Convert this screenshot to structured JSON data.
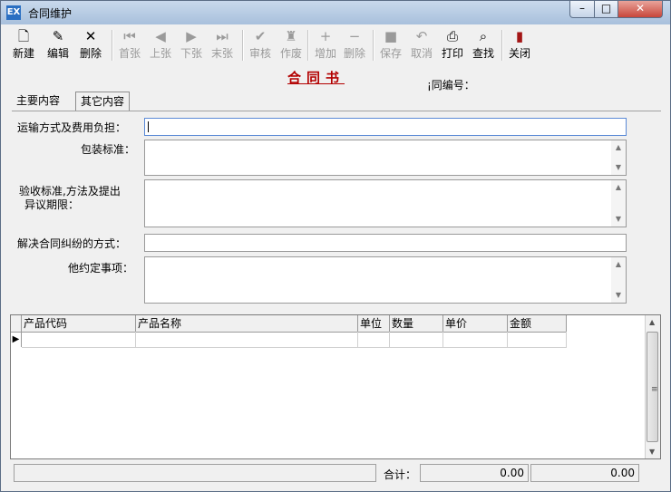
{
  "window": {
    "title": "合同维护",
    "app_icon": "EX"
  },
  "toolbar": {
    "new": "新建",
    "edit": "编辑",
    "delete": "删除",
    "first": "首张",
    "prev": "上张",
    "next": "下张",
    "last": "末张",
    "review": "审核",
    "void": "作废",
    "add": "增加",
    "remove": "删除",
    "save": "保存",
    "cancel": "取消",
    "print": "打印",
    "find": "查找",
    "close": "关闭"
  },
  "doc_title": "合同书",
  "contract_no_label": "¡同编号：",
  "tabs": {
    "main": "主要内容",
    "other": "其它内容"
  },
  "fields": {
    "transport": "运输方式及费用负担：",
    "packaging": "包装标准：",
    "inspection_line1": "验收标准,方法及提出",
    "inspection_line2": "异议期限：",
    "dispute": "解决合同纠纷的方式：",
    "other_terms": "他约定事项："
  },
  "grid": {
    "columns": [
      "产品代码",
      "产品名称",
      "单位",
      "数量",
      "单价",
      "金额"
    ]
  },
  "footer": {
    "total_label": "合计：",
    "total_1": "0.00",
    "total_2": "0.00"
  }
}
